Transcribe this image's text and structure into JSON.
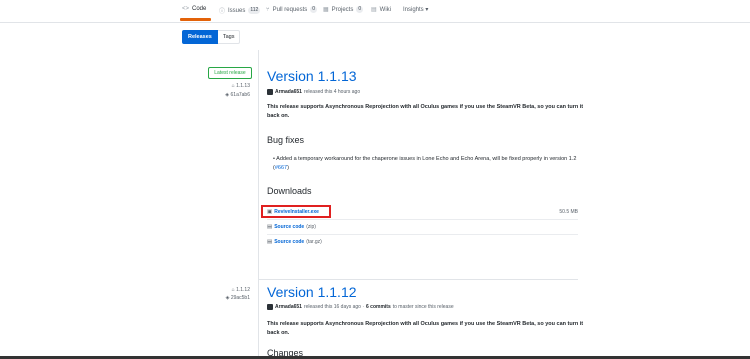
{
  "repo_tabs": [
    {
      "icon": "<>",
      "label": "Code"
    },
    {
      "icon": "ⓘ",
      "label": "Issues",
      "count": "112"
    },
    {
      "icon": "⑂",
      "label": "Pull requests",
      "count": "0"
    },
    {
      "icon": "▦",
      "label": "Projects",
      "count": "0"
    },
    {
      "icon": "▤",
      "label": "Wiki"
    },
    {
      "label": "Insights ▾"
    }
  ],
  "subnav": {
    "releases": "Releases",
    "tags": "Tags"
  },
  "release1": {
    "badge": "Latest release",
    "tag": "1.1.13",
    "commit": "61a7ab6",
    "title": "Version 1.1.13",
    "author": "Armada651",
    "released": "released this 4 hours ago",
    "description": "This release supports Asynchronous Reprojection with all Oculus games if you use the SteamVR Beta, so you can turn it back on.",
    "bug_heading": "Bug fixes",
    "bug_item": "Added a temporary workaround for the chaperone issues in Lone Echo and Echo Arena, will be fixed properly in version 1.2 (",
    "bug_link": "#667",
    "bug_end": ")",
    "downloads_heading": "Downloads",
    "downloads": [
      {
        "name": "ReviveInstaller.exe",
        "ext": "",
        "size": "50.5 MB"
      },
      {
        "name": "Source code",
        "ext": "(zip)",
        "size": ""
      },
      {
        "name": "Source code",
        "ext": "(tar.gz)",
        "size": ""
      }
    ]
  },
  "release2": {
    "tag": "1.1.12",
    "commit": "29ac5b1",
    "title": "Version 1.1.12",
    "author": "Armada651",
    "released": "released this 16 days ago ·",
    "commits": "6 commits",
    "commits_suffix": "to master since this release",
    "description": "This release supports Asynchronous Reprojection with all Oculus games if you use the SteamVR Beta, so you can turn it back on.",
    "changes_heading": "Changes"
  }
}
